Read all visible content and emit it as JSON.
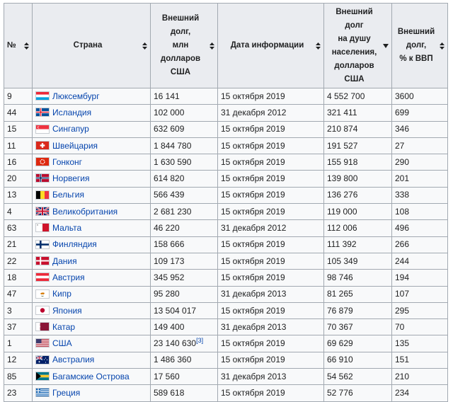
{
  "table": {
    "headers": {
      "num": "№",
      "country": "Страна",
      "debt": [
        "Внешний",
        "долг,",
        "млн",
        "долларов",
        "США"
      ],
      "date": "Дата информации",
      "per_capita": [
        "Внешний",
        "долг",
        "на душу",
        "населения,",
        "долларов",
        "США"
      ],
      "gdp": [
        "Внешний",
        "долг,",
        "% к ВВП"
      ]
    },
    "rows": [
      {
        "num": "9",
        "country": "Люксембург",
        "flag": "luxembourg-flag-icon",
        "debt": "16 141",
        "date": "15 октября 2019",
        "per_capita": "4 552 700",
        "gdp": "3600"
      },
      {
        "num": "44",
        "country": "Исландия",
        "flag": "iceland-flag-icon",
        "debt": "102 000",
        "date": "31 декабря 2012",
        "per_capita": "321 411",
        "gdp": "699"
      },
      {
        "num": "15",
        "country": "Сингапур",
        "flag": "singapore-flag-icon",
        "debt": "632 609",
        "date": "15 октября 2019",
        "per_capita": "210 874",
        "gdp": "346"
      },
      {
        "num": "11",
        "country": "Швейцария",
        "flag": "switzerland-flag-icon",
        "debt": "1 844 780",
        "date": "15 октября 2019",
        "per_capita": "191 527",
        "gdp": "27"
      },
      {
        "num": "16",
        "country": "Гонконг",
        "flag": "hongkong-flag-icon",
        "debt": "1 630 590",
        "date": "15 октября 2019",
        "per_capita": "155 918",
        "gdp": "290"
      },
      {
        "num": "20",
        "country": "Норвегия",
        "flag": "norway-flag-icon",
        "debt": "614 820",
        "date": "15 октября 2019",
        "per_capita": "139 800",
        "gdp": "201"
      },
      {
        "num": "13",
        "country": "Бельгия",
        "flag": "belgium-flag-icon",
        "debt": "566 439",
        "date": "15 октября 2019",
        "per_capita": "136 276",
        "gdp": "338"
      },
      {
        "num": "4",
        "country": "Великобритания",
        "flag": "uk-flag-icon",
        "debt": "2 681 230",
        "date": "15 октября 2019",
        "per_capita": "119 000",
        "gdp": "108"
      },
      {
        "num": "63",
        "country": "Мальта",
        "flag": "malta-flag-icon",
        "debt": "46 220",
        "date": "31 декабря 2012",
        "per_capita": "112 006",
        "gdp": "496"
      },
      {
        "num": "21",
        "country": "Финляндия",
        "flag": "finland-flag-icon",
        "debt": "158 666",
        "date": "15 октября 2019",
        "per_capita": "111 392",
        "gdp": "266"
      },
      {
        "num": "22",
        "country": "Дания",
        "flag": "denmark-flag-icon",
        "debt": "109 173",
        "date": "15 октября 2019",
        "per_capita": "105 349",
        "gdp": "244"
      },
      {
        "num": "18",
        "country": "Австрия",
        "flag": "austria-flag-icon",
        "debt": "345 952",
        "date": "15 октября 2019",
        "per_capita": "98 746",
        "gdp": "194"
      },
      {
        "num": "47",
        "country": "Кипр",
        "flag": "cyprus-flag-icon",
        "debt": "95 280",
        "date": "31 декабря 2013",
        "per_capita": "81 265",
        "gdp": "107"
      },
      {
        "num": "3",
        "country": "Япония",
        "flag": "japan-flag-icon",
        "debt": "13 504 017",
        "date": "15 октября 2019",
        "per_capita": "76 879",
        "gdp": "295"
      },
      {
        "num": "37",
        "country": "Катар",
        "flag": "qatar-flag-icon",
        "debt": "149 400",
        "date": "31 декабря 2013",
        "per_capita": "70 367",
        "gdp": "70"
      },
      {
        "num": "1",
        "country": "США",
        "flag": "usa-flag-icon",
        "debt": "23 140 630",
        "ref": "[3]",
        "date": "15 октября 2019",
        "per_capita": "69 629",
        "gdp": "135"
      },
      {
        "num": "12",
        "country": "Австралия",
        "flag": "australia-flag-icon",
        "debt": "1 486 360",
        "date": "15 октября 2019",
        "per_capita": "66 910",
        "gdp": "151"
      },
      {
        "num": "85",
        "country": "Багамские Острова",
        "flag": "bahamas-flag-icon",
        "debt": "17 560",
        "date": "31 декабря 2013",
        "per_capita": "54 562",
        "gdp": "210"
      },
      {
        "num": "23",
        "country": "Греция",
        "flag": "greece-flag-icon",
        "debt": "589 618",
        "date": "15 октября 2019",
        "per_capita": "52 776",
        "gdp": "234"
      }
    ]
  },
  "colors": {
    "link": "#0645ad",
    "header_bg": "#eaecf0",
    "cell_bg": "#f8f9fa",
    "border": "#a2a9b1",
    "text": "#202122"
  }
}
